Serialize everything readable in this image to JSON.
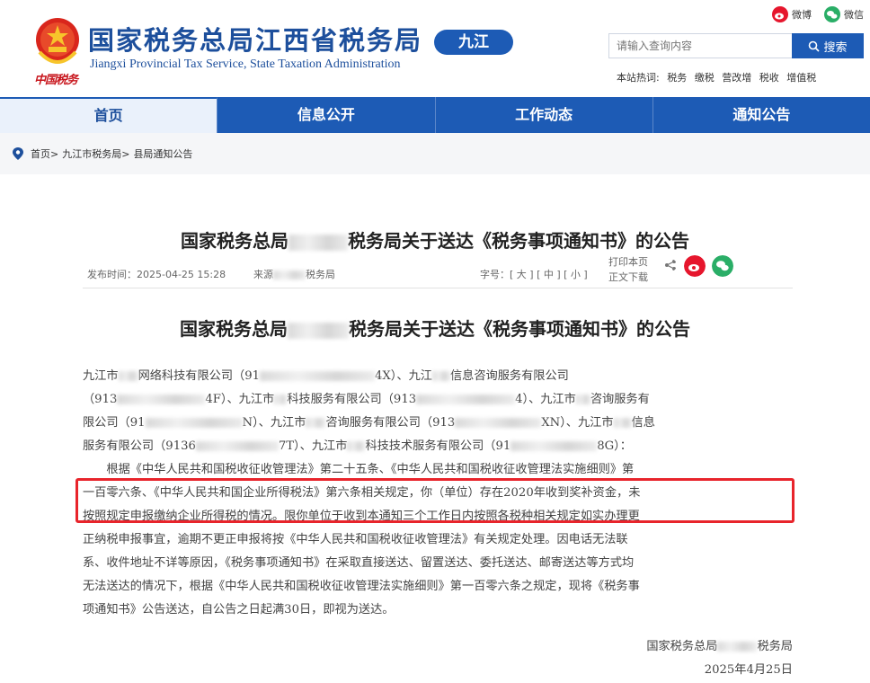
{
  "header": {
    "site_title": "国家税务总局江西省税务局",
    "site_subtitle": "Jiangxi Provincial Tax Service, State Taxation Administration",
    "seal_text": "中国税务",
    "region": "九江",
    "weibo_label": "微博",
    "wechat_label": "微信",
    "search_placeholder": "请输入查询内容",
    "search_button": "搜索",
    "hot_label": "本站热词:",
    "hot_words": [
      "税务",
      "缴税",
      "营改增",
      "税收",
      "增值税"
    ]
  },
  "nav": {
    "items": [
      "首页",
      "信息公开",
      "工作动态",
      "通知公告"
    ],
    "active": "首页"
  },
  "breadcrumb": {
    "items": [
      "首页>",
      "九江市税务局>",
      "县局通知公告"
    ]
  },
  "article": {
    "title_a": "国家税务总局",
    "title_b": "税务局关于送达《税务事项通知书》的公告",
    "publish_time": "发布时间：2025-04-25 15:28",
    "source_prefix": "来源",
    "source_suffix": "税务局",
    "font_size_ctrl": "字号：[ 大 ] [ 中 ] [ 小 ]",
    "print_label": "打印本页",
    "download_label": "正文下载",
    "subtitle_a": "国家税务总局",
    "subtitle_b": "税务局关于送达《税务事项通知书》的公告",
    "recipients": {
      "r1a": "九江市",
      "r1b": "网络科技有限公司（91",
      "r1c": "4X）、九江",
      "r1d": "信息咨询服务有限公司",
      "r2a": "（913",
      "r2b": "4F）、九江市",
      "r2c": "科技服务有限公司（913",
      "r2d": "4）、九江市",
      "r2e": "咨询服务有",
      "r3a": "限公司（91",
      "r3b": "N）、九江市",
      "r3c": "咨询服务有限公司（913",
      "r3d": "XN）、九江市",
      "r3e": "信息",
      "r4a": "服务有限公司（9136",
      "r4b": "7T）、九江市",
      "r4c": "科技技术服务有限公司（91",
      "r4d": "8G）："
    },
    "para_line1": "根据《中华人民共和国税收征收管理法》第二十五条、《中华人民共和国税收征收管理法实施细则》第",
    "para_line2": "一百零六条、《中华人民共和国企业所得税法》第六条相关规定，你（单位）存在2020年收到奖补资金，未",
    "para_line3": "按照规定申报缴纳企业所得税的情况。限你单位于收到本通知三个工作日内按照各税种相关规定如实办理更",
    "para_line4": "正纳税申报事宜，逾期不更正申报将按《中华人民共和国税收征收管理法》有关规定处理。因电话无法联",
    "para_line5": "系、收件地址不详等原因，《税务事项通知书》在采取直接送达、留置送达、委托送达、邮寄送达等方式均",
    "para_line6": "无法送达的情况下，根据《中华人民共和国税收征收管理法实施细则》第一百零六条之规定，现将《税务事",
    "para_line7": "项通知书》公告送达，自公告之日起满30日，即视为送达。",
    "sign_org_a": "国家税务总局",
    "sign_org_b": "税务局",
    "sign_date": "2025年4月25日"
  },
  "colors": {
    "primary": "#1d5bb5",
    "highlight": "#e8242b"
  }
}
